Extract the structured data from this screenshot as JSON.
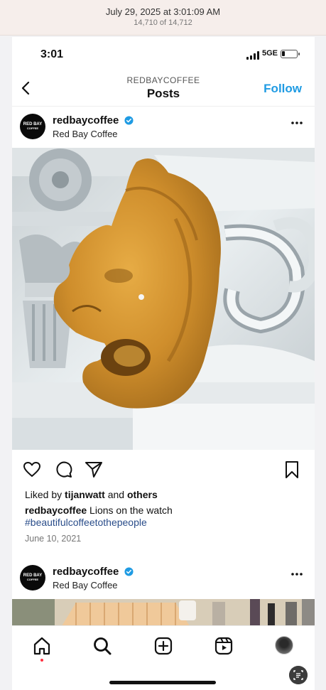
{
  "viewer": {
    "date": "July 29, 2025 at 3:01:09 AM",
    "count": "14,710 of 14,712"
  },
  "status_bar": {
    "time": "3:01",
    "network": "5GE"
  },
  "header": {
    "account": "REDBAYCOFFEE",
    "title": "Posts",
    "follow_label": "Follow"
  },
  "post": {
    "username": "redbaycoffee",
    "full_name": "Red Bay Coffee",
    "avatar_text": "RED BAY",
    "avatar_subtext": "COFFEE",
    "liked_prefix": "Liked by ",
    "liked_user": "tijanwatt",
    "liked_and": " and ",
    "liked_others": "others",
    "caption_user": "redbaycoffee",
    "caption_text": " Lions on the watch",
    "hashtag": "#beautifulcoffeetothepeople",
    "date": "June 10, 2021"
  },
  "post2": {
    "username": "redbaycoffee",
    "full_name": "Red Bay Coffee"
  },
  "colors": {
    "accent": "#1f9be3",
    "hashtag": "#2a4d8a",
    "notification": "#ff3040"
  },
  "icons": {
    "back": "chevron-left-icon",
    "verified": "verified-badge-icon",
    "more": "more-dots-icon",
    "like": "heart-icon",
    "comment": "comment-icon",
    "share": "send-icon",
    "save": "bookmark-icon",
    "home": "home-icon",
    "search": "search-icon",
    "create": "plus-square-icon",
    "reels": "reels-icon"
  }
}
